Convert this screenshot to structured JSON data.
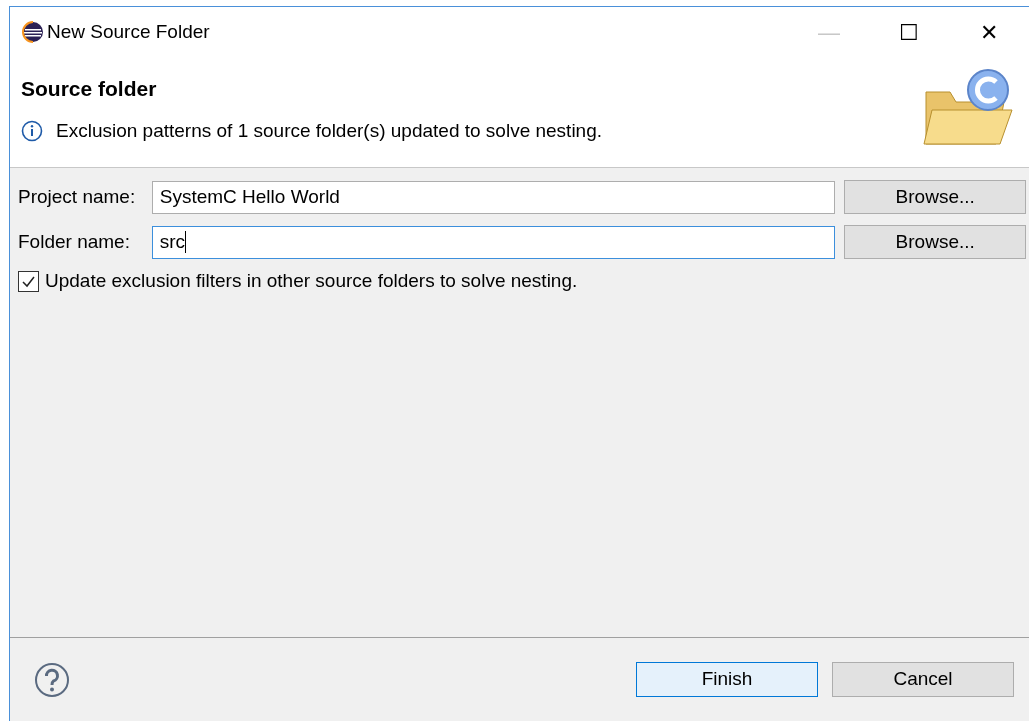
{
  "window": {
    "title": "New Source Folder",
    "controls": [
      "—",
      "☐",
      "✕"
    ]
  },
  "header": {
    "title": "Source folder",
    "message": "Exclusion patterns of 1 source folder(s) updated to solve nesting."
  },
  "fields": [
    {
      "label": "Project name:",
      "value": "SystemC Hello World",
      "focused": false,
      "button": "Browse..."
    },
    {
      "label": "Folder name:",
      "value": "src",
      "focused": true,
      "button": "Browse..."
    }
  ],
  "checkbox": {
    "label": "Update exclusion filters in other source folders to solve nesting.",
    "checked": true
  },
  "buttons": [
    {
      "label": "Finish",
      "default": true
    },
    {
      "label": "Cancel",
      "default": false
    }
  ]
}
